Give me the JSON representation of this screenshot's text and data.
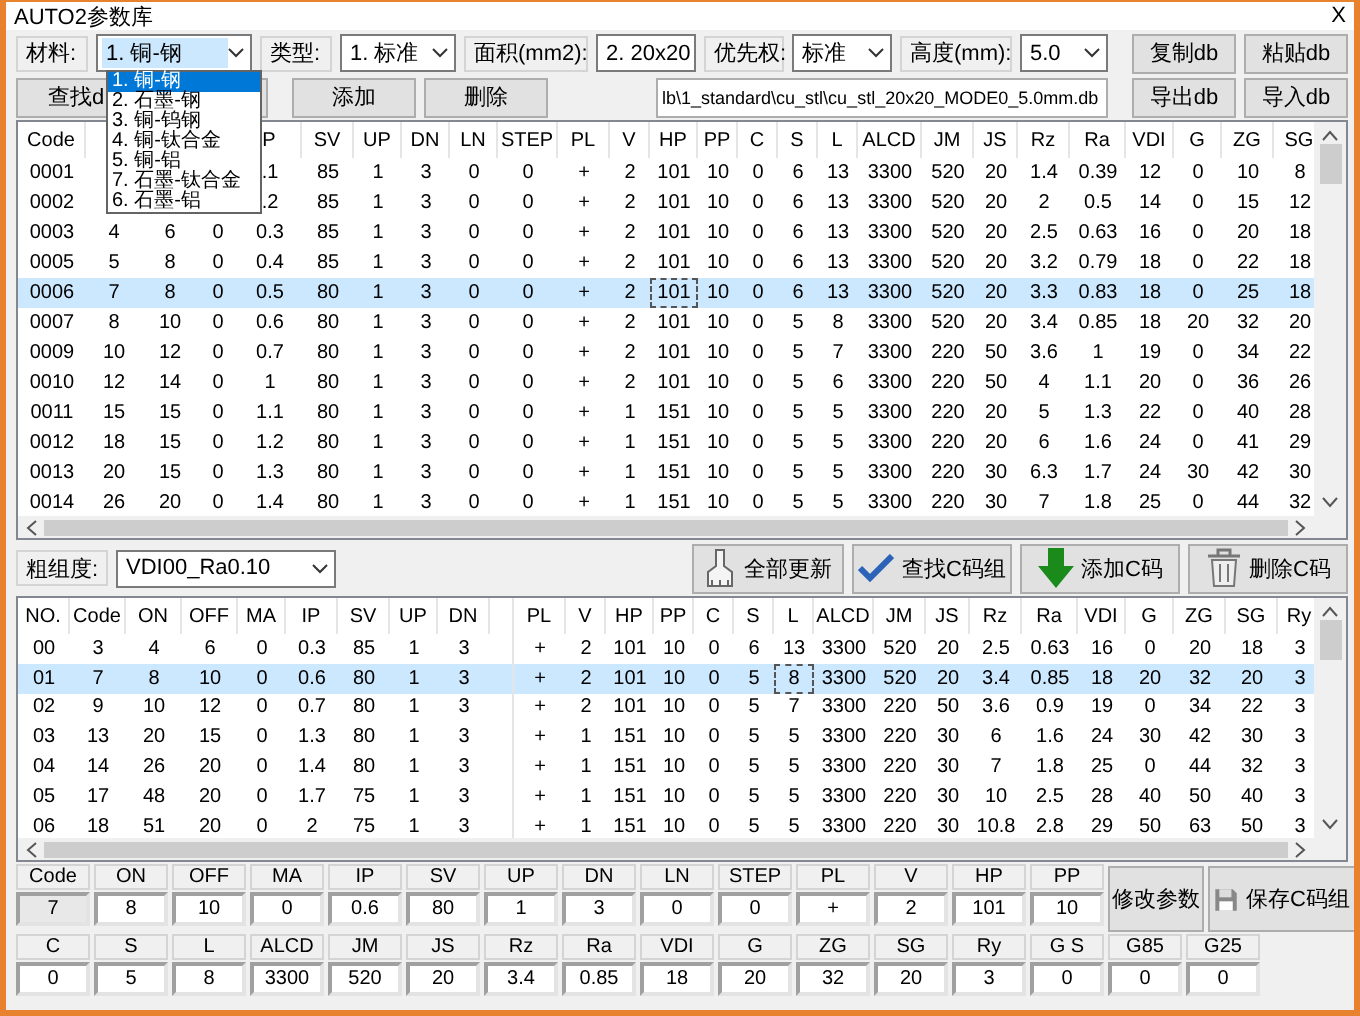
{
  "window": {
    "title": "AUTO2参数库",
    "close": "X"
  },
  "filters": [
    {
      "label": "材料:",
      "value": "1. 铜-钢",
      "open": true
    },
    {
      "label": "类型:",
      "value": "1. 标准",
      "open": false
    },
    {
      "label": "面积(mm2):",
      "value": "2. 20x20",
      "open": false
    },
    {
      "label": "优先权:",
      "value": "标准",
      "open": false
    },
    {
      "label": "高度(mm):",
      "value": "5.0",
      "open": false
    }
  ],
  "material_options": [
    {
      "label": "1. 铜-钢",
      "selected": true
    },
    {
      "label": "2. 石墨-钢",
      "selected": false
    },
    {
      "label": "3. 铜-钨钢",
      "selected": false
    },
    {
      "label": "4. 铜-钛合金",
      "selected": false
    },
    {
      "label": "5. 铜-铝",
      "selected": false
    },
    {
      "label": "7. 石墨-钛合金",
      "selected": false
    },
    {
      "label": "6. 石墨-铝",
      "selected": false
    }
  ],
  "db_buttons_top": [
    "复制db",
    "粘贴db"
  ],
  "action_buttons": [
    {
      "kind": "text",
      "label": "查找d"
    },
    {
      "kind": "covered"
    },
    {
      "kind": "text",
      "label": "添加"
    },
    {
      "kind": "text",
      "label": "删除"
    }
  ],
  "db_path": "lb\\1_standard\\cu_stl\\cu_stl_20x20_MODE0_5.0mm.db",
  "db_buttons_bottom": [
    "导出db",
    "导入db"
  ],
  "top_table": {
    "columns": [
      "Code",
      null,
      null,
      null,
      "P",
      "SV",
      "UP",
      "DN",
      "LN",
      "STEP",
      "PL",
      "V",
      "HP",
      "PP",
      "C",
      "S",
      "L",
      "ALCD",
      "JM",
      "JS",
      "Rz",
      "Ra",
      "VDI",
      "G",
      "ZG",
      "SG"
    ],
    "rows": [
      {
        "selected": false,
        "cells": [
          "0001",
          null,
          null,
          null,
          ".1",
          "85",
          "1",
          "3",
          "0",
          "0",
          "+",
          "2",
          "101",
          "10",
          "0",
          "6",
          "13",
          "3300",
          "520",
          "20",
          "1.4",
          "0.39",
          "12",
          "0",
          "10",
          "8"
        ]
      },
      {
        "selected": false,
        "cells": [
          "0002",
          null,
          null,
          null,
          ".2",
          "85",
          "1",
          "3",
          "0",
          "0",
          "+",
          "2",
          "101",
          "10",
          "0",
          "6",
          "13",
          "3300",
          "520",
          "20",
          "2",
          "0.5",
          "14",
          "0",
          "15",
          "12"
        ]
      },
      {
        "selected": false,
        "cells": [
          "0003",
          "4",
          "6",
          "0",
          "0.3",
          "85",
          "1",
          "3",
          "0",
          "0",
          "+",
          "2",
          "101",
          "10",
          "0",
          "6",
          "13",
          "3300",
          "520",
          "20",
          "2.5",
          "0.63",
          "16",
          "0",
          "20",
          "18"
        ]
      },
      {
        "selected": false,
        "cells": [
          "0005",
          "5",
          "8",
          "0",
          "0.4",
          "85",
          "1",
          "3",
          "0",
          "0",
          "+",
          "2",
          "101",
          "10",
          "0",
          "6",
          "13",
          "3300",
          "520",
          "20",
          "3.2",
          "0.79",
          "18",
          "0",
          "22",
          "18"
        ]
      },
      {
        "selected": true,
        "cells": [
          "0006",
          "7",
          "8",
          "0",
          "0.5",
          "80",
          "1",
          "3",
          "0",
          "0",
          "+",
          "2",
          {
            "text": "101",
            "focused": true
          },
          "10",
          "0",
          "6",
          "13",
          "3300",
          "520",
          "20",
          "3.3",
          "0.83",
          "18",
          "0",
          "25",
          "18"
        ]
      },
      {
        "selected": false,
        "cells": [
          "0007",
          "8",
          "10",
          "0",
          "0.6",
          "80",
          "1",
          "3",
          "0",
          "0",
          "+",
          "2",
          "101",
          "10",
          "0",
          "5",
          "8",
          "3300",
          "520",
          "20",
          "3.4",
          "0.85",
          "18",
          "20",
          "32",
          "20"
        ]
      },
      {
        "selected": false,
        "cells": [
          "0009",
          "10",
          "12",
          "0",
          "0.7",
          "80",
          "1",
          "3",
          "0",
          "0",
          "+",
          "2",
          "101",
          "10",
          "0",
          "5",
          "7",
          "3300",
          "220",
          "50",
          "3.6",
          "1",
          "19",
          "0",
          "34",
          "22"
        ]
      },
      {
        "selected": false,
        "cells": [
          "0010",
          "12",
          "14",
          "0",
          "1",
          "80",
          "1",
          "3",
          "0",
          "0",
          "+",
          "2",
          "101",
          "10",
          "0",
          "5",
          "6",
          "3300",
          "220",
          "50",
          "4",
          "1.1",
          "20",
          "0",
          "36",
          "26"
        ]
      },
      {
        "selected": false,
        "cells": [
          "0011",
          "15",
          "15",
          "0",
          "1.1",
          "80",
          "1",
          "3",
          "0",
          "0",
          "+",
          "1",
          "151",
          "10",
          "0",
          "5",
          "5",
          "3300",
          "220",
          "20",
          "5",
          "1.3",
          "22",
          "0",
          "40",
          "28"
        ]
      },
      {
        "selected": false,
        "cells": [
          "0012",
          "18",
          "15",
          "0",
          "1.2",
          "80",
          "1",
          "3",
          "0",
          "0",
          "+",
          "1",
          "151",
          "10",
          "0",
          "5",
          "5",
          "3300",
          "220",
          "20",
          "6",
          "1.6",
          "24",
          "0",
          "41",
          "29"
        ]
      },
      {
        "selected": false,
        "cells": [
          "0013",
          "20",
          "15",
          "0",
          "1.3",
          "80",
          "1",
          "3",
          "0",
          "0",
          "+",
          "1",
          "151",
          "10",
          "0",
          "5",
          "5",
          "3300",
          "220",
          "30",
          "6.3",
          "1.7",
          "24",
          "30",
          "42",
          "30"
        ]
      },
      {
        "selected": false,
        "cells": [
          "0014",
          "26",
          "20",
          "0",
          "1.4",
          "80",
          "1",
          "3",
          "0",
          "0",
          "+",
          "1",
          "151",
          "10",
          "0",
          "5",
          "5",
          "3300",
          "220",
          "30",
          "7",
          "1.8",
          "25",
          "0",
          "44",
          "32"
        ]
      }
    ]
  },
  "roughness": {
    "label": "粗组度:",
    "value": "VDI00_Ra0.10"
  },
  "group_buttons": [
    {
      "label": "全部更新",
      "kind": "update"
    },
    {
      "label": "查找C码组",
      "kind": "find"
    },
    {
      "label": "添加C码",
      "kind": "add"
    },
    {
      "label": "删除C码",
      "kind": "delete"
    }
  ],
  "lower_table": {
    "columns": [
      "NO.",
      "Code",
      "ON",
      "OFF",
      "MA",
      "IP",
      "SV",
      "UP",
      "DN",
      "PL",
      "V",
      "HP",
      "PP",
      "C",
      "S",
      "L",
      "ALCD",
      "JM",
      "JS",
      "Rz",
      "Ra",
      "VDI",
      "G",
      "ZG",
      "SG",
      "Ry"
    ],
    "rows": [
      {
        "selected": false,
        "cells": [
          "00",
          "3",
          "4",
          "6",
          "0",
          "0.3",
          "85",
          "1",
          "3",
          "+",
          "2",
          "101",
          "10",
          "0",
          "6",
          "13",
          "3300",
          "520",
          "20",
          "2.5",
          "0.63",
          "16",
          "0",
          "20",
          "18",
          "3"
        ]
      },
      {
        "selected": true,
        "cells": [
          "01",
          "7",
          "8",
          "10",
          "0",
          "0.6",
          "80",
          "1",
          "3",
          "+",
          "2",
          "101",
          "10",
          "0",
          "5",
          {
            "text": "8",
            "focused": true
          },
          "3300",
          "520",
          "20",
          "3.4",
          "0.85",
          "18",
          "20",
          "32",
          "20",
          "3"
        ]
      },
      {
        "selected": false,
        "cells": [
          "02",
          "9",
          "10",
          "12",
          "0",
          "0.7",
          "80",
          "1",
          "3",
          "+",
          "2",
          "101",
          "10",
          "0",
          "5",
          "7",
          "3300",
          "220",
          "50",
          "3.6",
          "0.9",
          "19",
          "0",
          "34",
          "22",
          "3"
        ]
      },
      {
        "selected": false,
        "cells": [
          "03",
          "13",
          "20",
          "15",
          "0",
          "1.3",
          "80",
          "1",
          "3",
          "+",
          "1",
          "151",
          "10",
          "0",
          "5",
          "5",
          "3300",
          "220",
          "30",
          "6",
          "1.6",
          "24",
          "30",
          "42",
          "30",
          "3"
        ]
      },
      {
        "selected": false,
        "cells": [
          "04",
          "14",
          "26",
          "20",
          "0",
          "1.4",
          "80",
          "1",
          "3",
          "+",
          "1",
          "151",
          "10",
          "0",
          "5",
          "5",
          "3300",
          "220",
          "30",
          "7",
          "1.8",
          "25",
          "0",
          "44",
          "32",
          "3"
        ]
      },
      {
        "selected": false,
        "cells": [
          "05",
          "17",
          "48",
          "20",
          "0",
          "1.7",
          "75",
          "1",
          "3",
          "+",
          "1",
          "151",
          "10",
          "0",
          "5",
          "5",
          "3300",
          "220",
          "30",
          "10",
          "2.5",
          "28",
          "40",
          "50",
          "40",
          "3"
        ]
      },
      {
        "selected": false,
        "cells": [
          "06",
          "18",
          "51",
          "20",
          "0",
          "2",
          "75",
          "1",
          "3",
          "+",
          "1",
          "151",
          "10",
          "0",
          "5",
          "5",
          "3300",
          "220",
          "30",
          "10.8",
          "2.8",
          "29",
          "50",
          "63",
          "50",
          "3"
        ]
      }
    ]
  },
  "editor": {
    "fields_row1": [
      {
        "label": "Code",
        "value": "7",
        "disabled": true
      },
      {
        "label": "ON",
        "value": "8",
        "disabled": false
      },
      {
        "label": "OFF",
        "value": "10",
        "disabled": false
      },
      {
        "label": "MA",
        "value": "0",
        "disabled": false
      },
      {
        "label": "IP",
        "value": "0.6",
        "disabled": false
      },
      {
        "label": "SV",
        "value": "80",
        "disabled": false
      },
      {
        "label": "UP",
        "value": "1",
        "disabled": false
      },
      {
        "label": "DN",
        "value": "3",
        "disabled": false
      },
      {
        "label": "LN",
        "value": "0",
        "disabled": false
      },
      {
        "label": "STEP",
        "value": "0",
        "disabled": false
      },
      {
        "label": "PL",
        "value": "+",
        "disabled": false
      },
      {
        "label": "V",
        "value": "2",
        "disabled": false
      },
      {
        "label": "HP",
        "value": "101",
        "disabled": false
      },
      {
        "label": "PP",
        "value": "10",
        "disabled": false
      }
    ],
    "buttons": [
      {
        "label": "修改参数",
        "kind": "modify"
      },
      {
        "label": "保存C码组",
        "kind": "save"
      }
    ],
    "fields_row2": [
      {
        "label": "C",
        "value": "0",
        "disabled": false
      },
      {
        "label": "S",
        "value": "5",
        "disabled": false
      },
      {
        "label": "L",
        "value": "8",
        "disabled": false
      },
      {
        "label": "ALCD",
        "value": "3300",
        "disabled": false
      },
      {
        "label": "JM",
        "value": "520",
        "disabled": false
      },
      {
        "label": "JS",
        "value": "20",
        "disabled": false
      },
      {
        "label": "Rz",
        "value": "3.4",
        "disabled": false
      },
      {
        "label": "Ra",
        "value": "0.85",
        "disabled": false
      },
      {
        "label": "VDI",
        "value": "18",
        "disabled": false
      },
      {
        "label": "G",
        "value": "20",
        "disabled": false
      },
      {
        "label": "ZG",
        "value": "32",
        "disabled": false
      },
      {
        "label": "SG",
        "value": "20",
        "disabled": false
      },
      {
        "label": "Ry",
        "value": "3",
        "disabled": false
      },
      {
        "label": "G S",
        "value": "0",
        "disabled": false
      },
      {
        "label": "G85",
        "value": "0",
        "disabled": false
      },
      {
        "label": "G25",
        "value": "0",
        "disabled": false
      }
    ]
  }
}
